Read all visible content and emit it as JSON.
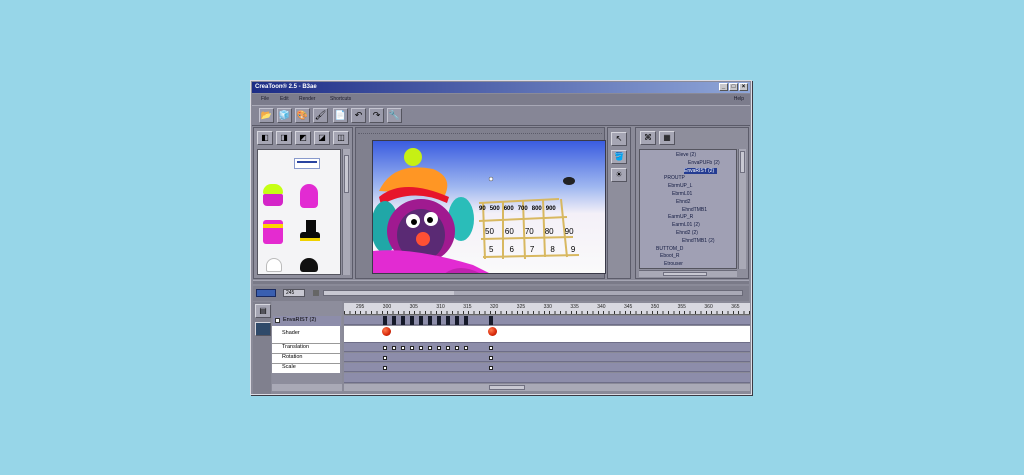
{
  "window": {
    "title": "CreaToon® 2.5 - B3ae",
    "minimize": "_",
    "maximize": "□",
    "close": "×"
  },
  "menu": {
    "items": [
      "File",
      "Edit",
      "Render",
      "Shortcuts"
    ],
    "help": "Help"
  },
  "tree": {
    "rows": [
      {
        "label": "Eleve (2)",
        "selected": false
      },
      {
        "label": "EnvaPUFb (2)",
        "selected": false
      },
      {
        "label": "EnvaRIST (2)",
        "selected": true
      },
      {
        "label": "PROUTP",
        "selected": false
      },
      {
        "label": "EbrmUP_L",
        "selected": false
      },
      {
        "label": "EbrmL01",
        "selected": false
      },
      {
        "label": "Ehnd2",
        "selected": false
      },
      {
        "label": "EhndTMB1",
        "selected": false
      },
      {
        "label": "EarmUP_R",
        "selected": false
      },
      {
        "label": "EarmL01 (2)",
        "selected": false
      },
      {
        "label": "Ehnd2 (2)",
        "selected": false
      },
      {
        "label": "EhndTMB1 (2)",
        "selected": false
      },
      {
        "label": "BUTTOM_D",
        "selected": false
      },
      {
        "label": "Eboot_R",
        "selected": false
      },
      {
        "label": "Etrouser",
        "selected": false
      }
    ]
  },
  "timeline": {
    "frame_field": "245",
    "object_name": "EnvaRIST (2)",
    "ruler": [
      "295",
      "300",
      "305",
      "310",
      "315",
      "320",
      "325",
      "330",
      "335",
      "340",
      "345",
      "350",
      "355",
      "360",
      "365"
    ],
    "tracks": [
      "Shader",
      "Translation",
      "Rotation",
      "Scale"
    ]
  },
  "canvas": {
    "grid_row1": [
      "90",
      "500",
      "600",
      "700",
      "800",
      "900"
    ],
    "grid_row2": [
      "50",
      "60",
      "70",
      "80",
      "90"
    ],
    "grid_row3": [
      "5",
      "6",
      "7",
      "8",
      "9"
    ]
  },
  "colors": {
    "title_start": "#1d2c86",
    "title_end": "#8fa6d8",
    "panel": "#8e8e9c",
    "track": "#8d8daa",
    "keyframe_red": "#d8280a"
  }
}
